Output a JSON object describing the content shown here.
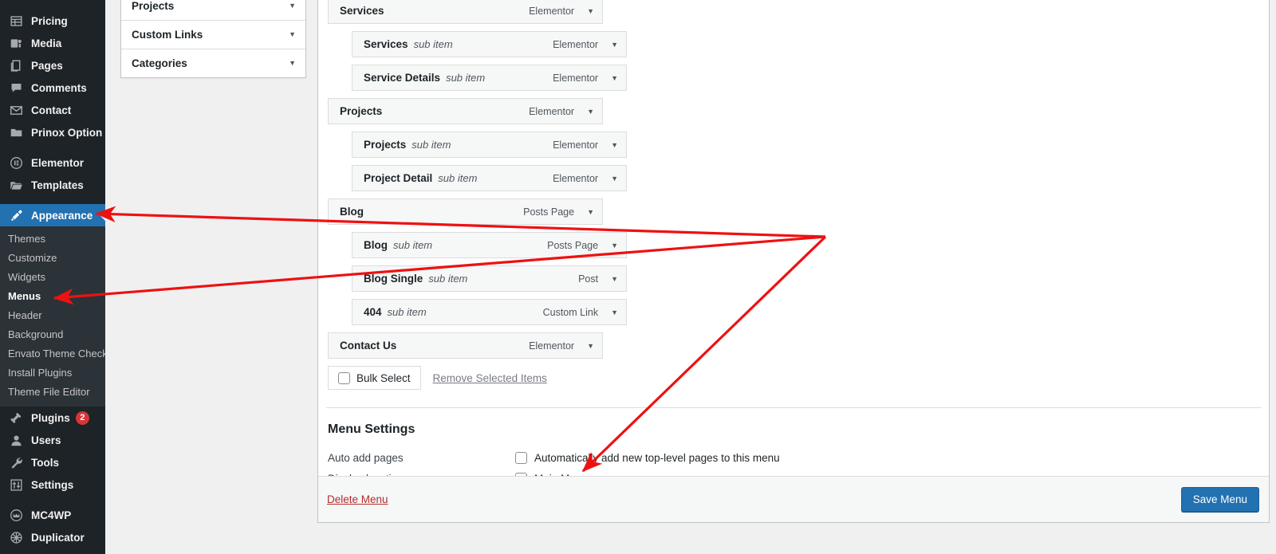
{
  "sidebar": {
    "items": [
      {
        "label": "Pricing",
        "icon": "table-icon",
        "state": "normal"
      },
      {
        "label": "Media",
        "icon": "media-icon",
        "state": "normal"
      },
      {
        "label": "Pages",
        "icon": "pages-icon",
        "state": "normal"
      },
      {
        "label": "Comments",
        "icon": "comments-icon",
        "state": "normal"
      },
      {
        "label": "Contact",
        "icon": "envelope-icon",
        "state": "normal"
      },
      {
        "label": "Prinox Option",
        "icon": "folder-icon",
        "state": "normal"
      },
      {
        "label": "Elementor",
        "icon": "elementor-icon",
        "state": "normal",
        "gap_before": true
      },
      {
        "label": "Templates",
        "icon": "templates-icon",
        "state": "normal"
      },
      {
        "label": "Appearance",
        "icon": "brush-icon",
        "state": "active",
        "gap_before": true
      }
    ],
    "submenu": [
      {
        "label": "Themes",
        "current": false
      },
      {
        "label": "Customize",
        "current": false
      },
      {
        "label": "Widgets",
        "current": false
      },
      {
        "label": "Menus",
        "current": true
      },
      {
        "label": "Header",
        "current": false
      },
      {
        "label": "Background",
        "current": false
      },
      {
        "label": "Envato Theme Check",
        "current": false
      },
      {
        "label": "Install Plugins",
        "current": false
      },
      {
        "label": "Theme File Editor",
        "current": false
      }
    ],
    "items_lower": [
      {
        "label": "Plugins",
        "icon": "plug-icon",
        "badge": "2"
      },
      {
        "label": "Users",
        "icon": "user-icon",
        "badge": ""
      },
      {
        "label": "Tools",
        "icon": "wrench-icon",
        "badge": ""
      },
      {
        "label": "Settings",
        "icon": "settings-icon",
        "badge": ""
      },
      {
        "label": "MC4WP",
        "icon": "mc4wp-icon",
        "badge": "",
        "gap_before": true
      },
      {
        "label": "Duplicator",
        "icon": "duplicator-icon",
        "badge": ""
      }
    ]
  },
  "accordion": {
    "rows": [
      {
        "label": "Projects",
        "caret": "▼"
      },
      {
        "label": "Custom Links",
        "caret": "▼"
      },
      {
        "label": "Categories",
        "caret": "▼"
      }
    ]
  },
  "menu_items": [
    {
      "title": "Services",
      "sub_label": "",
      "type": "Elementor",
      "depth": 0,
      "caret": "▼"
    },
    {
      "title": "Services",
      "sub_label": "sub item",
      "type": "Elementor",
      "depth": 1,
      "caret": "▼"
    },
    {
      "title": "Service Details",
      "sub_label": "sub item",
      "type": "Elementor",
      "depth": 1,
      "caret": "▼"
    },
    {
      "title": "Projects",
      "sub_label": "",
      "type": "Elementor",
      "depth": 0,
      "caret": "▼"
    },
    {
      "title": "Projects",
      "sub_label": "sub item",
      "type": "Elementor",
      "depth": 1,
      "caret": "▼"
    },
    {
      "title": "Project Detail",
      "sub_label": "sub item",
      "type": "Elementor",
      "depth": 1,
      "caret": "▼"
    },
    {
      "title": "Blog",
      "sub_label": "",
      "type": "Posts Page",
      "depth": 0,
      "caret": "▼"
    },
    {
      "title": "Blog",
      "sub_label": "sub item",
      "type": "Posts Page",
      "depth": 1,
      "caret": "▼"
    },
    {
      "title": "Blog Single",
      "sub_label": "sub item",
      "type": "Post",
      "depth": 1,
      "caret": "▼"
    },
    {
      "title": "404",
      "sub_label": "sub item",
      "type": "Custom Link",
      "depth": 1,
      "caret": "▼"
    },
    {
      "title": "Contact Us",
      "sub_label": "",
      "type": "Elementor",
      "depth": 0,
      "caret": "▼"
    }
  ],
  "bulk": {
    "checkbox_label": "Bulk Select",
    "checked": false,
    "remove_link": "Remove Selected Items"
  },
  "settings": {
    "heading": "Menu Settings",
    "auto_add_label": "Auto add pages",
    "auto_add_option": "Automatically add new top-level pages to this menu",
    "auto_add_checked": false,
    "display_location_label": "Display location",
    "display_location_option": "Main Menu",
    "display_location_checked": true
  },
  "footer": {
    "delete_label": "Delete Menu",
    "save_label": "Save Menu"
  },
  "colors": {
    "accent_blue": "#2271b1",
    "sidebar_bg": "#1d2327",
    "submenu_bg": "#2c3338",
    "badge_red": "#d63638",
    "delete_red": "#b32d2e",
    "annotation_red": "#ee1111",
    "row_bg": "#f6f7f7"
  }
}
